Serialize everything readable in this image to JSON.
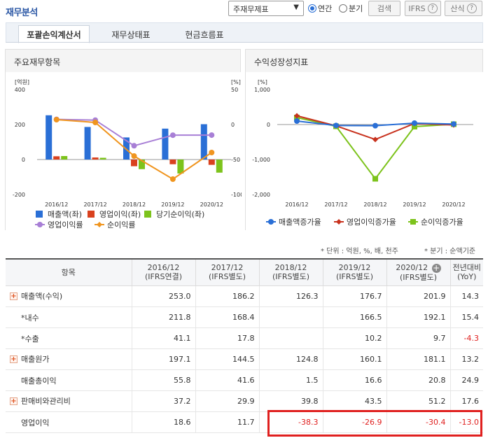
{
  "header": {
    "title": "재무분석",
    "select_value": "주재무제표",
    "radio_annual": "연간",
    "radio_quarter": "분기",
    "search_label": "검색",
    "ifrs_label": "IFRS",
    "formula_label": "산식",
    "help_glyph": "?"
  },
  "tabs": [
    "포괄손익계산서",
    "재무상태표",
    "현금흐름표"
  ],
  "left_panel": {
    "title": "주요재무항목",
    "unit_left": "[억원]",
    "unit_right": "[%]",
    "legend": [
      "매출액(좌)",
      "영업이익(좌)",
      "당기순이익(좌)",
      "영업이익률",
      "순이익률"
    ]
  },
  "right_panel": {
    "title": "수익성장성지표",
    "unit": "[%]",
    "legend": [
      "매출액증가율",
      "영업이익증가율",
      "순이익증가율"
    ]
  },
  "chart_data": [
    {
      "type": "bar",
      "title": "주요재무항목",
      "categories": [
        "2016/12",
        "2017/12",
        "2018/12",
        "2019/12",
        "2020/12"
      ],
      "ylim": [
        -200,
        400
      ],
      "y_ticks": [
        "400",
        "200",
        "0",
        "-200"
      ],
      "y2lim": [
        -100,
        50
      ],
      "y2_ticks": [
        "50",
        "0",
        "-50",
        "-100"
      ],
      "series": [
        {
          "name": "매출액(좌)",
          "kind": "bar",
          "axis": "left",
          "color": "#2a6fd6",
          "values": [
            253.0,
            186.2,
            126.3,
            176.7,
            201.9
          ]
        },
        {
          "name": "영업이익(좌)",
          "kind": "bar",
          "axis": "left",
          "color": "#d9411e",
          "values": [
            18.6,
            11.7,
            -38.3,
            -26.9,
            -30.4
          ]
        },
        {
          "name": "당기순이익(좌)",
          "kind": "bar",
          "axis": "left",
          "color": "#7dc31c",
          "values": [
            20,
            10,
            -55,
            -80,
            -75
          ]
        },
        {
          "name": "영업이익률",
          "kind": "line",
          "axis": "right",
          "color": "#a87fd6",
          "values": [
            7.4,
            6.3,
            -30.3,
            -15.2,
            -15.1
          ]
        },
        {
          "name": "순이익률",
          "kind": "line",
          "axis": "right",
          "color": "#f0951f",
          "values": [
            7.0,
            3.0,
            -45.0,
            -78.0,
            -40.0
          ]
        }
      ]
    },
    {
      "type": "line",
      "title": "수익성장성지표",
      "categories": [
        "2016/12",
        "2017/12",
        "2018/12",
        "2019/12",
        "2020/12"
      ],
      "ylim": [
        -2000,
        1000
      ],
      "y_ticks": [
        "1,000",
        "0",
        "-1,000",
        "-2,000"
      ],
      "series": [
        {
          "name": "매출액증가율",
          "color": "#2a6fd6",
          "marker": "circle",
          "values": [
            100,
            -26.4,
            -32.2,
            39.9,
            14.3
          ]
        },
        {
          "name": "영업이익증가율",
          "color": "#c8321e",
          "marker": "diamond",
          "values": [
            250,
            -37.1,
            -427,
            29.8,
            -13.0
          ]
        },
        {
          "name": "순이익증가율",
          "color": "#7dc31c",
          "marker": "square",
          "values": [
            200,
            -50,
            -1550,
            -60,
            10
          ]
        }
      ]
    }
  ],
  "notes": {
    "unit": "* 단위 : 억원, %, 배, 천주",
    "quarter": "* 분기 : 순액기준"
  },
  "table": {
    "head": [
      {
        "l1": "항목",
        "l2": ""
      },
      {
        "l1": "2016/12",
        "l2": "(IFRS연결)"
      },
      {
        "l1": "2017/12",
        "l2": "(IFRS별도)"
      },
      {
        "l1": "2018/12",
        "l2": "(IFRS별도)"
      },
      {
        "l1": "2019/12",
        "l2": "(IFRS별도)"
      },
      {
        "l1": "2020/12",
        "l2": "(IFRS별도)"
      },
      {
        "l1": "전년대비",
        "l2": "(YoY)"
      }
    ],
    "add_icon": "+",
    "rows": [
      {
        "label": "매출액(수익)",
        "expand": true,
        "cells": [
          "253.0",
          "186.2",
          "126.3",
          "176.7",
          "201.9",
          "14.3"
        ]
      },
      {
        "label": "*내수",
        "expand": false,
        "cells": [
          "211.8",
          "168.4",
          "",
          "166.5",
          "192.1",
          "15.4"
        ]
      },
      {
        "label": "*수출",
        "expand": false,
        "cells": [
          "41.1",
          "17.8",
          "",
          "10.2",
          "9.7",
          "-4.3"
        ]
      },
      {
        "label": "매출원가",
        "expand": true,
        "cells": [
          "197.1",
          "144.5",
          "124.8",
          "160.1",
          "181.1",
          "13.2"
        ]
      },
      {
        "label": "매출총이익",
        "expand": false,
        "cells": [
          "55.8",
          "41.6",
          "1.5",
          "16.6",
          "20.8",
          "24.9"
        ]
      },
      {
        "label": "판매비와관리비",
        "expand": true,
        "cells": [
          "37.2",
          "29.9",
          "39.8",
          "43.5",
          "51.2",
          "17.6"
        ]
      },
      {
        "label": "영업이익",
        "expand": false,
        "cells": [
          "18.6",
          "11.7",
          "-38.3",
          "-26.9",
          "-30.4",
          "-13.0"
        ]
      }
    ]
  }
}
